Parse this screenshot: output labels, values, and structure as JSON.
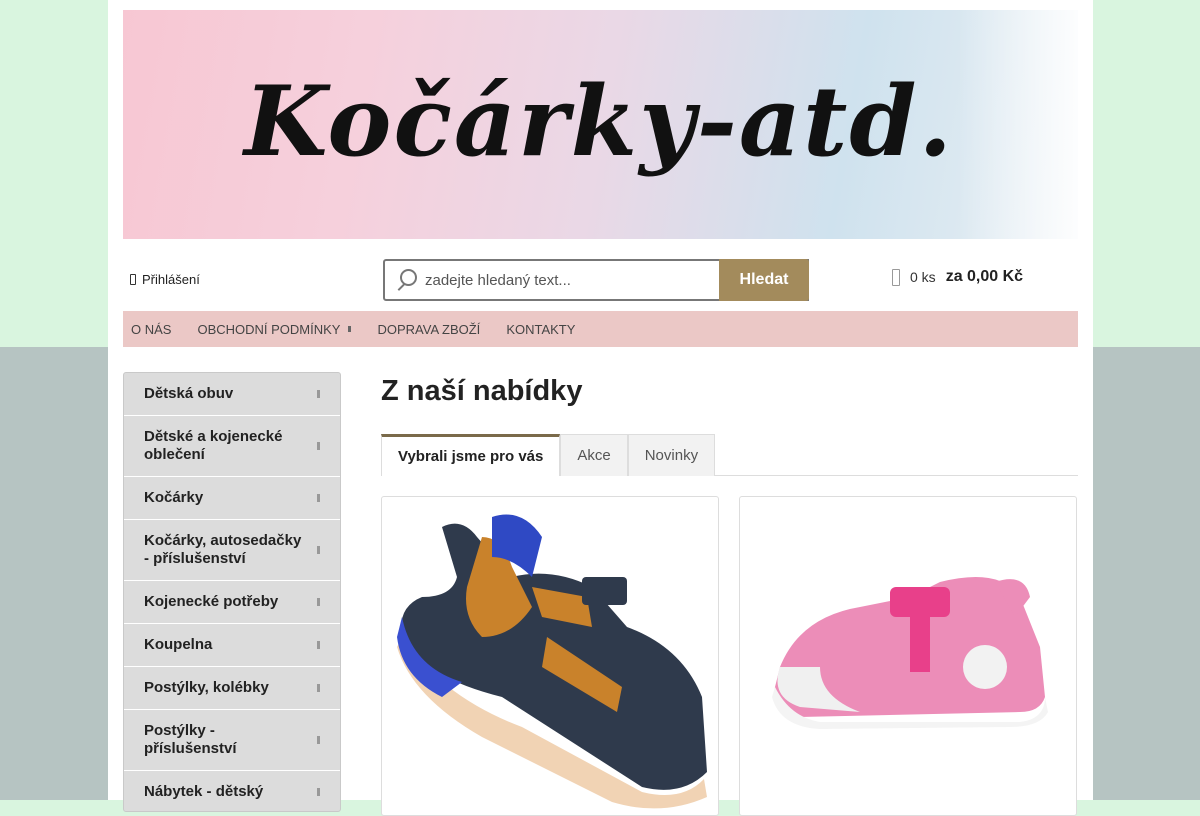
{
  "banner": {
    "logo_text": "Kočárky-atd."
  },
  "header": {
    "login_label": "Přihlášení",
    "search_placeholder": "zadejte hledaný text...",
    "search_button": "Hledat",
    "cart_count": "0 ks",
    "cart_total": "za 0,00 Kč"
  },
  "nav": {
    "items": [
      {
        "label": "O NÁS"
      },
      {
        "label": "OBCHODNÍ PODMÍNKY"
      },
      {
        "label": "DOPRAVA ZBOŽÍ"
      },
      {
        "label": "KONTAKTY"
      }
    ]
  },
  "sidebar": {
    "items": [
      {
        "label": "Dětská obuv"
      },
      {
        "label": "Dětské a kojenecké oblečení"
      },
      {
        "label": "Kočárky"
      },
      {
        "label": "Kočárky, autosedačky - příslušenství"
      },
      {
        "label": "Kojenecké potřeby"
      },
      {
        "label": "Koupelna"
      },
      {
        "label": "Postýlky, kolébky"
      },
      {
        "label": "Postýlky - příslušenství"
      },
      {
        "label": "Nábytek - dětský"
      }
    ]
  },
  "main": {
    "heading": "Z naší nabídky",
    "tabs": [
      {
        "label": "Vybrali jsme pro vás"
      },
      {
        "label": "Akce"
      },
      {
        "label": "Novinky"
      }
    ]
  },
  "colors": {
    "accent": "#a38b5c",
    "nav_bg": "#ebc8c6",
    "sidebar_bg": "#dcdcdc"
  }
}
